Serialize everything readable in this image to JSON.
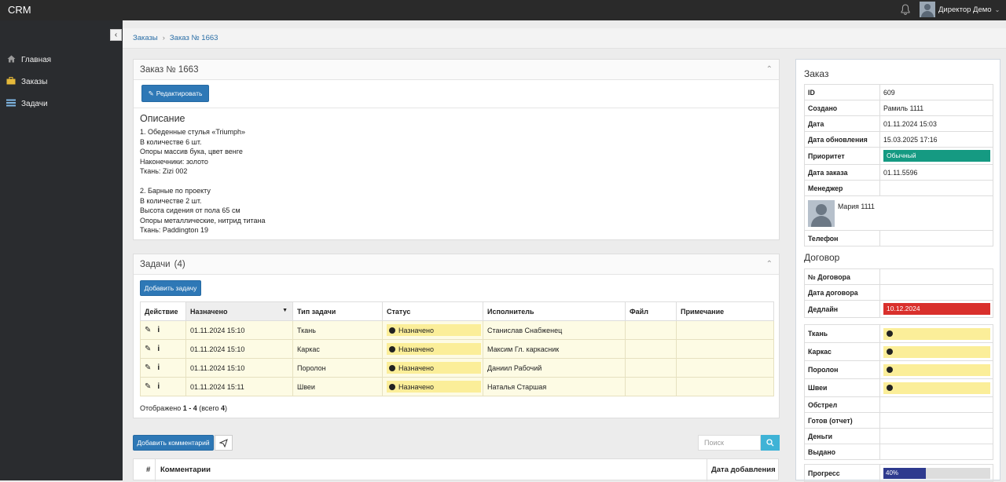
{
  "app": {
    "brand": "CRM",
    "user_name": "Директор Демо"
  },
  "sidebar": {
    "items": [
      {
        "label": "Главная",
        "icon": "home-icon"
      },
      {
        "label": "Заказы",
        "icon": "briefcase-icon"
      },
      {
        "label": "Задачи",
        "icon": "list-icon"
      }
    ]
  },
  "breadcrumb": {
    "root": "Заказы",
    "current": "Заказ № 1663"
  },
  "order_panel": {
    "title": "Заказ № 1663",
    "edit_label": "Редактировать",
    "description_title": "Описание",
    "description_lines": [
      "1. Обеденные стулья «Triumph»",
      "В количестве 6 шт.",
      "Опоры массив бука, цвет венге",
      "Наконечники: золото",
      "Ткань: Zizi 002",
      "",
      "2. Барные по проекту",
      "В количестве 2 шт.",
      "Высота сидения от пола 65 см",
      "Опоры металлические, нитрид титана",
      "Ткань: Paddington 19"
    ]
  },
  "tasks_panel": {
    "title": "Задачи",
    "count": "(4)",
    "add_label": "Добавить задачу",
    "columns": [
      "Действие",
      "Назначено",
      "Тип задачи",
      "Статус",
      "Исполнитель",
      "Файл",
      "Примечание"
    ],
    "rows": [
      {
        "assigned": "01.11.2024 15:10",
        "type": "Ткань",
        "status": "Назначено",
        "executor": "Станислав Снабженец",
        "file": "",
        "note": ""
      },
      {
        "assigned": "01.11.2024 15:10",
        "type": "Каркас",
        "status": "Назначено",
        "executor": "Максим Гл. каркасник",
        "file": "",
        "note": ""
      },
      {
        "assigned": "01.11.2024 15:10",
        "type": "Поролон",
        "status": "Назначено",
        "executor": "Даниил Рабочий",
        "file": "",
        "note": ""
      },
      {
        "assigned": "01.11.2024 15:11",
        "type": "Швеи",
        "status": "Назначено",
        "executor": "Наталья Старшая",
        "file": "",
        "note": ""
      }
    ],
    "shown_prefix": "Отображено ",
    "shown_range": "1 - 4",
    "shown_mid": " (всего ",
    "shown_total": "4",
    "shown_suffix": ")"
  },
  "comments": {
    "add_label": "Добавить комментарий",
    "search_placeholder": "Поиск",
    "col_num": "#",
    "col_comments": "Комментарии",
    "col_date": "Дата добавления"
  },
  "order_info": {
    "title": "Заказ",
    "rows": [
      {
        "k": "ID",
        "v": "609"
      },
      {
        "k": "Создано",
        "v": "Рамиль 1111"
      },
      {
        "k": "Дата",
        "v": "01.11.2024 15:03"
      },
      {
        "k": "Дата обновления",
        "v": "15.03.2025 17:16"
      },
      {
        "k": "Приоритет",
        "v": "Обычный"
      },
      {
        "k": "Дата заказа",
        "v": "01.11.5596"
      },
      {
        "k": "Менеджер",
        "v": ""
      }
    ],
    "manager_name": "Мария 1111",
    "phone_label": "Телефон",
    "phone": "",
    "priority_color": "#159a82"
  },
  "contract": {
    "title": "Договор",
    "number_label": "№ Договора",
    "number": "",
    "date_label": "Дата договора",
    "date": "",
    "deadline_label": "Дедлайн",
    "deadline": "10.12.2024",
    "deadline_color": "#d9302c"
  },
  "stages": {
    "items": [
      "Ткань",
      "Каркас",
      "Поролон",
      "Швеи"
    ],
    "plain": [
      "Обстрел",
      "Готов (отчет)",
      "Деньги",
      "Выдано"
    ],
    "progress_label": "Прогресс",
    "progress_text": "40%",
    "progress_value": 0.4
  }
}
